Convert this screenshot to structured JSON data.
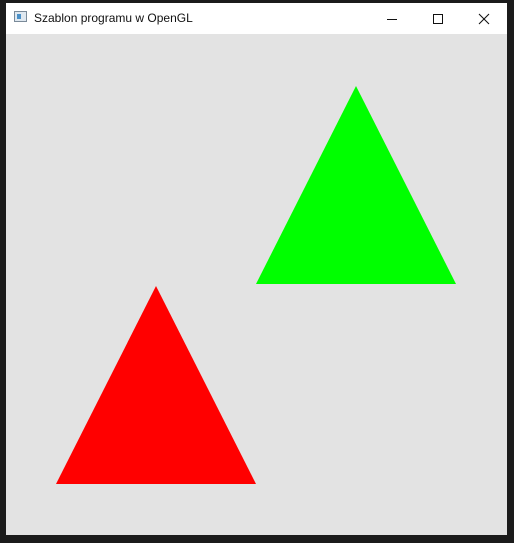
{
  "window": {
    "title": "Szablon programu w OpenGL"
  },
  "colors": {
    "background": "#e3e3e3",
    "triangle_green": "#00ff00",
    "triangle_red": "#ff0000"
  },
  "icons": {
    "app": "window-app-icon",
    "minimize": "minimize-icon",
    "maximize": "maximize-icon",
    "close": "close-icon"
  }
}
